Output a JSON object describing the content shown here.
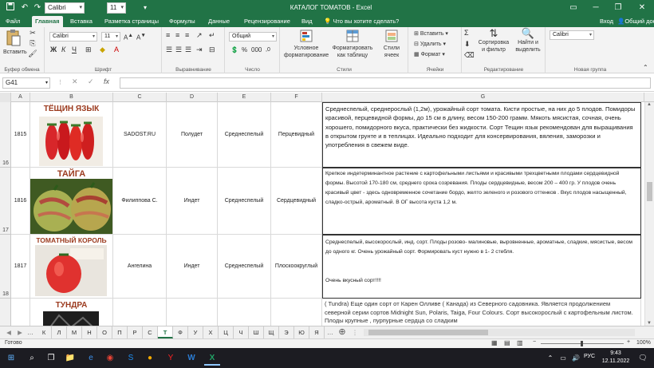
{
  "titlebar": {
    "font_name": "Calibri",
    "font_size": "11",
    "document_title": "КАТАЛОГ ТОМАТОВ - Excel"
  },
  "ribbon_tabs": [
    "Файл",
    "Главная",
    "Вставка",
    "Разметка страницы",
    "Формулы",
    "Данные",
    "Рецензирование",
    "Вид"
  ],
  "tell_me": "Что вы хотите сделать?",
  "signin": "Вход",
  "share": "Общий доступ",
  "ribbon": {
    "clipboard": {
      "paste": "Вставить",
      "label": "Буфер обмена"
    },
    "font": {
      "name": "Calibri",
      "size": "11",
      "label": "Шрифт"
    },
    "alignment": {
      "label": "Выравнивание"
    },
    "number": {
      "format": "Общий",
      "label": "Число"
    },
    "styles": {
      "conditional": "Условное",
      "conditional2": "форматирование",
      "as_table": "Форматировать",
      "as_table2": "как таблицу",
      "cell_styles": "Стили",
      "cell_styles2": "ячеек",
      "label": "Стили"
    },
    "cells": {
      "insert": "Вставить",
      "delete": "Удалить",
      "format": "Формат",
      "label": "Ячейки"
    },
    "editing": {
      "sort": "Сортировка",
      "sort2": "и фильтр",
      "find": "Найти и",
      "find2": "выделить",
      "label": "Редактирование"
    },
    "newgroup": {
      "font": "Calibri",
      "label": "Новая группа"
    }
  },
  "formula_bar": {
    "cell_ref": "G41",
    "fx": "fx",
    "value": ""
  },
  "columns": [
    "A",
    "B",
    "C",
    "D",
    "E",
    "F",
    "G"
  ],
  "rows": [
    {
      "row_num": "16",
      "id": "1815",
      "name": "ТЁЩИН ЯЗЫК",
      "author": "SADOST.RU",
      "type": "Полудет",
      "ripening": "Среднеспелый",
      "color": "Перцевидный",
      "description": "Среднеспелый, среднерослый (1,2м), урожайный сорт томата. Кисти простые, на них до 5 плодов. Помидоры красивой, перцевидной формы, до 15 см в длину, весом 150-200 грамм. Мякоть мясистая, сочная, очень хорошего, помидорного вкуса, практически без жидкости. Сорт Тещин язык рекомендован для выращивания в открытом грунте и в теплицах. Идеально подходит для консервирования, вяления, заморозки и употребления в свежем виде."
    },
    {
      "row_num": "17",
      "id": "1816",
      "name": "ТАЙГА",
      "author": "Филиппова С.",
      "type": "Индет",
      "ripening": "Среднеспелый",
      "color": "Сердцевидный",
      "description": "Крепкое индетерминантное растение с картофельными листьями и красивыми трехцветными плодами сердцевидной формы. Высотой 170-180 см, среднего срока созревания. Плоды сердцевидные, весом 200 – 400 гр. У плодов очень красивый цвет - здесь одновременное сочетание бордо, желто зеленого и розового оттенков . Вкус плодов насыщенный, сладко-острый, ароматный. В ОГ высота куста 1,2 м."
    },
    {
      "row_num": "18",
      "id": "1817",
      "name": "ТОМАТНЫЙ КОРОЛЬ",
      "author": "Ангелина",
      "type": "Индет",
      "ripening": "Среднеспелый",
      "color": "Плоскоокруглый",
      "description": "Среднеспелый, высокорослый, инд. сорт. Плоды розово- малиновые, выровненные, ароматные, сладкие, мясистые, весом до одного кг. Очень урожайный сорт. Формировать куст нужно в 1- 2 стебля.",
      "description2": "Очень вкусный сорт!!!!"
    },
    {
      "row_num": "",
      "id": "",
      "name": "ТУНДРА",
      "author": "",
      "type": "",
      "ripening": "",
      "color": "",
      "description": "( Tundra) Еще один сорт от Карен Олливе ( Канада) из Северного садовника. Является продолжением северной серии сортов Midnight Sun, Polaris, Taiga, Four Colours. Сорт высокорослый с картофельным листом. Плоды крупные , пурпурные сердца со сладким"
    }
  ],
  "sheet_tabs": [
    "К",
    "Л",
    "М",
    "Н",
    "О",
    "П",
    "Р",
    "С",
    "Т",
    "Ф",
    "У",
    "Х",
    "Ц",
    "Ч",
    "Ш",
    "Щ",
    "Э",
    "Ю",
    "Я"
  ],
  "active_sheet": "Т",
  "status": {
    "ready": "Готово",
    "zoom": "100%"
  },
  "taskbar": {
    "lang": "РУС",
    "time": "9:43",
    "date": "12.11.2022"
  }
}
